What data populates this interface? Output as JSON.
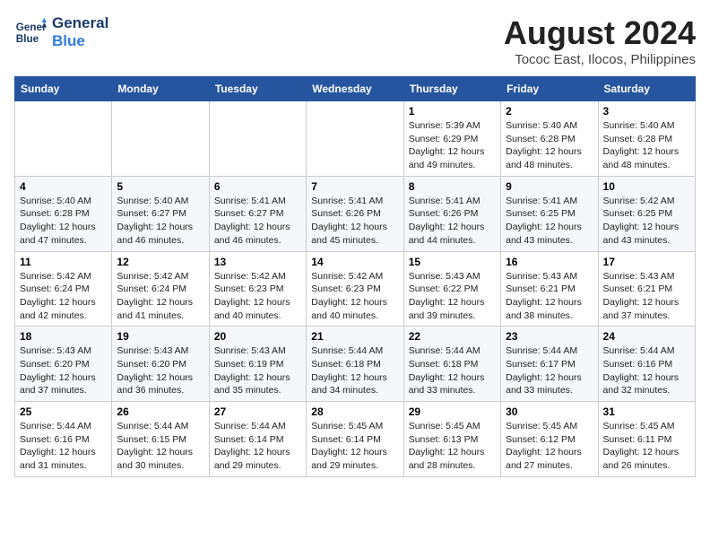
{
  "logo": {
    "line1": "General",
    "line2": "Blue"
  },
  "title": "August 2024",
  "location": "Tococ East, Ilocos, Philippines",
  "weekdays": [
    "Sunday",
    "Monday",
    "Tuesday",
    "Wednesday",
    "Thursday",
    "Friday",
    "Saturday"
  ],
  "weeks": [
    [
      {
        "day": "",
        "info": ""
      },
      {
        "day": "",
        "info": ""
      },
      {
        "day": "",
        "info": ""
      },
      {
        "day": "",
        "info": ""
      },
      {
        "day": "1",
        "info": "Sunrise: 5:39 AM\nSunset: 6:29 PM\nDaylight: 12 hours and 49 minutes."
      },
      {
        "day": "2",
        "info": "Sunrise: 5:40 AM\nSunset: 6:28 PM\nDaylight: 12 hours and 48 minutes."
      },
      {
        "day": "3",
        "info": "Sunrise: 5:40 AM\nSunset: 6:28 PM\nDaylight: 12 hours and 48 minutes."
      }
    ],
    [
      {
        "day": "4",
        "info": "Sunrise: 5:40 AM\nSunset: 6:28 PM\nDaylight: 12 hours and 47 minutes."
      },
      {
        "day": "5",
        "info": "Sunrise: 5:40 AM\nSunset: 6:27 PM\nDaylight: 12 hours and 46 minutes."
      },
      {
        "day": "6",
        "info": "Sunrise: 5:41 AM\nSunset: 6:27 PM\nDaylight: 12 hours and 46 minutes."
      },
      {
        "day": "7",
        "info": "Sunrise: 5:41 AM\nSunset: 6:26 PM\nDaylight: 12 hours and 45 minutes."
      },
      {
        "day": "8",
        "info": "Sunrise: 5:41 AM\nSunset: 6:26 PM\nDaylight: 12 hours and 44 minutes."
      },
      {
        "day": "9",
        "info": "Sunrise: 5:41 AM\nSunset: 6:25 PM\nDaylight: 12 hours and 43 minutes."
      },
      {
        "day": "10",
        "info": "Sunrise: 5:42 AM\nSunset: 6:25 PM\nDaylight: 12 hours and 43 minutes."
      }
    ],
    [
      {
        "day": "11",
        "info": "Sunrise: 5:42 AM\nSunset: 6:24 PM\nDaylight: 12 hours and 42 minutes."
      },
      {
        "day": "12",
        "info": "Sunrise: 5:42 AM\nSunset: 6:24 PM\nDaylight: 12 hours and 41 minutes."
      },
      {
        "day": "13",
        "info": "Sunrise: 5:42 AM\nSunset: 6:23 PM\nDaylight: 12 hours and 40 minutes."
      },
      {
        "day": "14",
        "info": "Sunrise: 5:42 AM\nSunset: 6:23 PM\nDaylight: 12 hours and 40 minutes."
      },
      {
        "day": "15",
        "info": "Sunrise: 5:43 AM\nSunset: 6:22 PM\nDaylight: 12 hours and 39 minutes."
      },
      {
        "day": "16",
        "info": "Sunrise: 5:43 AM\nSunset: 6:21 PM\nDaylight: 12 hours and 38 minutes."
      },
      {
        "day": "17",
        "info": "Sunrise: 5:43 AM\nSunset: 6:21 PM\nDaylight: 12 hours and 37 minutes."
      }
    ],
    [
      {
        "day": "18",
        "info": "Sunrise: 5:43 AM\nSunset: 6:20 PM\nDaylight: 12 hours and 37 minutes."
      },
      {
        "day": "19",
        "info": "Sunrise: 5:43 AM\nSunset: 6:20 PM\nDaylight: 12 hours and 36 minutes."
      },
      {
        "day": "20",
        "info": "Sunrise: 5:43 AM\nSunset: 6:19 PM\nDaylight: 12 hours and 35 minutes."
      },
      {
        "day": "21",
        "info": "Sunrise: 5:44 AM\nSunset: 6:18 PM\nDaylight: 12 hours and 34 minutes."
      },
      {
        "day": "22",
        "info": "Sunrise: 5:44 AM\nSunset: 6:18 PM\nDaylight: 12 hours and 33 minutes."
      },
      {
        "day": "23",
        "info": "Sunrise: 5:44 AM\nSunset: 6:17 PM\nDaylight: 12 hours and 33 minutes."
      },
      {
        "day": "24",
        "info": "Sunrise: 5:44 AM\nSunset: 6:16 PM\nDaylight: 12 hours and 32 minutes."
      }
    ],
    [
      {
        "day": "25",
        "info": "Sunrise: 5:44 AM\nSunset: 6:16 PM\nDaylight: 12 hours and 31 minutes."
      },
      {
        "day": "26",
        "info": "Sunrise: 5:44 AM\nSunset: 6:15 PM\nDaylight: 12 hours and 30 minutes."
      },
      {
        "day": "27",
        "info": "Sunrise: 5:44 AM\nSunset: 6:14 PM\nDaylight: 12 hours and 29 minutes."
      },
      {
        "day": "28",
        "info": "Sunrise: 5:45 AM\nSunset: 6:14 PM\nDaylight: 12 hours and 29 minutes."
      },
      {
        "day": "29",
        "info": "Sunrise: 5:45 AM\nSunset: 6:13 PM\nDaylight: 12 hours and 28 minutes."
      },
      {
        "day": "30",
        "info": "Sunrise: 5:45 AM\nSunset: 6:12 PM\nDaylight: 12 hours and 27 minutes."
      },
      {
        "day": "31",
        "info": "Sunrise: 5:45 AM\nSunset: 6:11 PM\nDaylight: 12 hours and 26 minutes."
      }
    ]
  ]
}
